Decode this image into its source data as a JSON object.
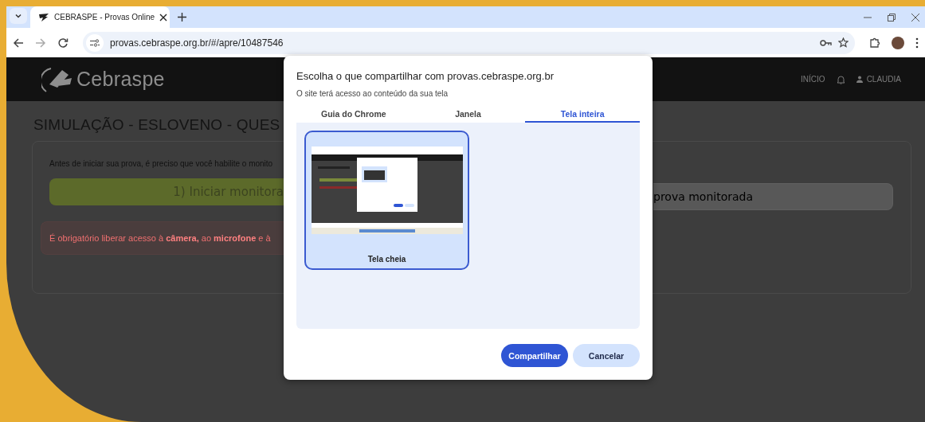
{
  "browser": {
    "tab": {
      "title": "CEBRASPE - Provas Online"
    },
    "url": "provas.cebraspe.org.br/#/apre/10487546"
  },
  "site_header": {
    "logo": "Cebraspe",
    "nav": "INÍCIO",
    "user": "CLAUDIA"
  },
  "page": {
    "title": "SIMULAÇÃO - ESLOVENO - QUES",
    "instruction": "Antes de iniciar sua prova, é preciso que você habilite o monito",
    "start_button": "1) Iniciar monitora",
    "second_button": "prova monitorada",
    "alert": "É obrigatório liberar acesso à **câmera,** ao **microfone** e à"
  },
  "dialog": {
    "title": "Escolha o que compartilhar com provas.cebraspe.org.br",
    "subtitle": "O site terá acesso ao conteúdo da sua tela",
    "tabs": [
      {
        "label": "Guia do Chrome",
        "selected": false
      },
      {
        "label": "Janela",
        "selected": false
      },
      {
        "label": "Tela inteira",
        "selected": true
      }
    ],
    "sources": [
      {
        "label": "Tela cheia",
        "selected": true
      }
    ],
    "buttons": [
      {
        "label": "Compartilhar",
        "kind": "primary"
      },
      {
        "label": "Cancelar",
        "kind": "secondary"
      }
    ]
  }
}
